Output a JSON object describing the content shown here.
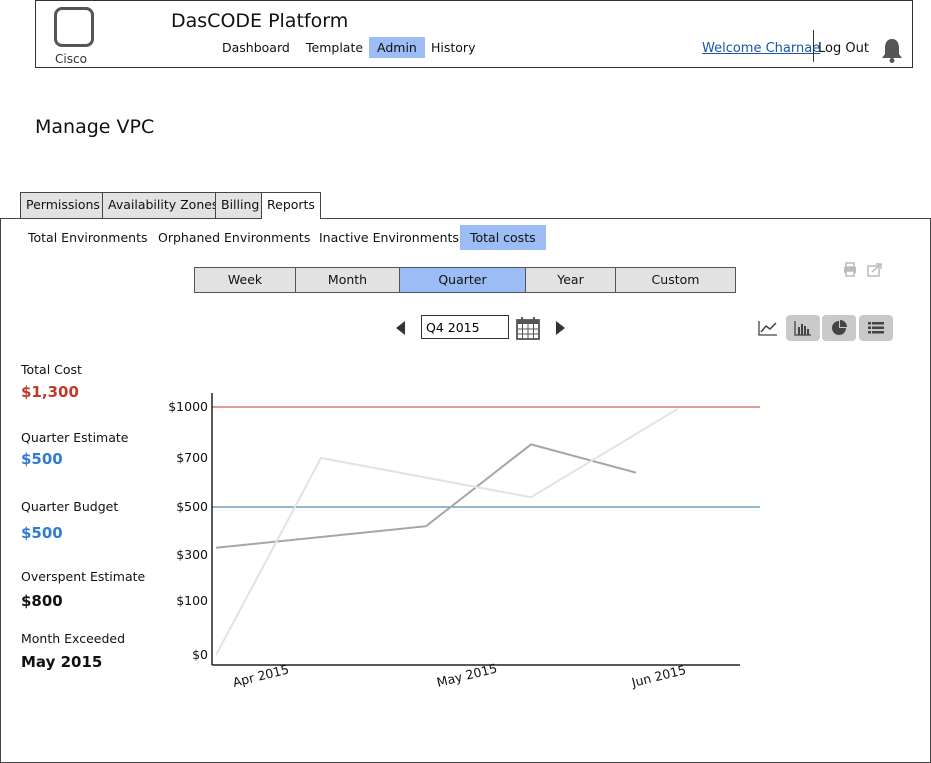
{
  "header": {
    "logo_text": "Cisco",
    "app_title": "DasCODE Platform",
    "nav": [
      "Dashboard",
      "Template",
      "Admin",
      "History"
    ],
    "active_nav": "Admin",
    "welcome": "Welcome Charnae",
    "logout": "Log Out"
  },
  "page_title": "Manage VPC",
  "tabs": [
    "Permissions",
    "Availability Zones",
    "Billing",
    "Reports"
  ],
  "active_tab": "Reports",
  "subtabs": [
    "Total Environments",
    "Orphaned Environments",
    "Inactive Environments",
    "Total costs"
  ],
  "active_subtab": "Total costs",
  "periods": [
    "Week",
    "Month",
    "Quarter",
    "Year",
    "Custom"
  ],
  "active_period": "Quarter",
  "date_value": "Q4 2015",
  "stats": [
    {
      "label": "Total Cost",
      "value": "$1,300",
      "color": "#c0392b"
    },
    {
      "label": "Quarter Estimate",
      "value": "$500",
      "color": "#2f7bd6"
    },
    {
      "label": "Quarter Budget",
      "value": "$500",
      "color": "#2f7bd6"
    },
    {
      "label": "Overspent Estimate",
      "value": "$800",
      "color": "#111111"
    },
    {
      "label": "Month Exceeded",
      "value": "May 2015",
      "color": "#111111"
    }
  ],
  "chart_data": {
    "type": "line",
    "x_labels": [
      "Apr 2015",
      "May 2015",
      "Jun 2015"
    ],
    "y_tick_labels": [
      "$0",
      "$100",
      "$300",
      "$500",
      "$700",
      "$1000"
    ],
    "y_ticks": [
      0,
      100,
      300,
      500,
      700,
      1000
    ],
    "reference_lines": [
      {
        "value": 1000,
        "color": "#c0392b"
      },
      {
        "value": 500,
        "color": "#2a6f97"
      }
    ],
    "series": [
      {
        "color": "#a6a6a6",
        "points": [
          [
            0,
            330
          ],
          [
            1,
            420
          ],
          [
            1.5,
            780
          ],
          [
            2,
            640
          ]
        ]
      },
      {
        "color": "#e2e2e2",
        "points": [
          [
            0,
            0
          ],
          [
            0.5,
            700
          ],
          [
            1.5,
            540
          ],
          [
            2.2,
            990
          ]
        ]
      }
    ]
  }
}
